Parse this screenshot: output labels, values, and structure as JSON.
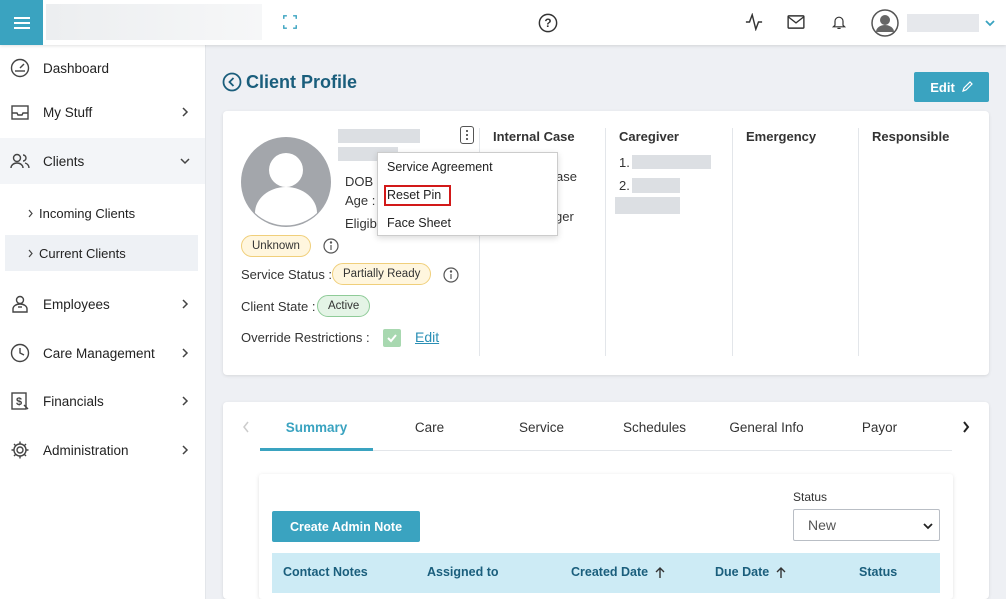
{
  "header": {
    "icons": [
      "hamburger-icon",
      "expand-icon",
      "help-icon",
      "activity-icon",
      "mail-icon",
      "bell-icon",
      "user-avatar-icon",
      "chevron-down-icon"
    ],
    "accent": "#3aa3c0"
  },
  "sidebar": {
    "items": [
      {
        "label": "Dashboard",
        "icon": "gauge-icon"
      },
      {
        "label": "My Stuff",
        "icon": "inbox-icon"
      },
      {
        "label": "Clients",
        "icon": "users-icon"
      },
      {
        "label": "Employees",
        "icon": "employee-icon"
      },
      {
        "label": "Care Management",
        "icon": "clock-icon"
      },
      {
        "label": "Financials",
        "icon": "dollar-icon"
      },
      {
        "label": "Administration",
        "icon": "gear-icon"
      }
    ],
    "clients_sub": [
      {
        "label": "Incoming Clients"
      },
      {
        "label": "Current Clients"
      }
    ]
  },
  "page": {
    "title": "Client Profile",
    "edit_label": "Edit"
  },
  "profile": {
    "dob_label": "DOB :",
    "age_label": "Age :",
    "eligibility_label": "Eligibi",
    "unknown_badge": "Unknown",
    "service_status_label": "Service Status :",
    "service_status_value": "Partially Ready",
    "client_state_label": "Client State :",
    "client_state_value": "Active",
    "override_label": "Override Restrictions :",
    "override_edit": "Edit",
    "col_internal_case": "Internal Case Manager",
    "col_internal_case_partial": "ase",
    "col_internal_case_partial2": "ger",
    "col_caregiver": "Caregiver",
    "caregiver_1": "1.",
    "caregiver_2": "2.",
    "col_emergency": "Emergency",
    "col_responsible": "Responsible"
  },
  "context_menu": {
    "items": [
      "Service Agreement",
      "Reset Pin",
      "Face Sheet"
    ],
    "highlight_color": "#d21919"
  },
  "tabs": {
    "items": [
      "Summary",
      "Care",
      "Service",
      "Schedules",
      "General Info",
      "Payor"
    ],
    "active": "Summary"
  },
  "summary": {
    "create_button": "Create Admin Note",
    "status_label": "Status",
    "status_value": "New",
    "columns": [
      "Contact Notes",
      "Assigned to",
      "Created Date",
      "Due Date",
      "Status"
    ]
  }
}
